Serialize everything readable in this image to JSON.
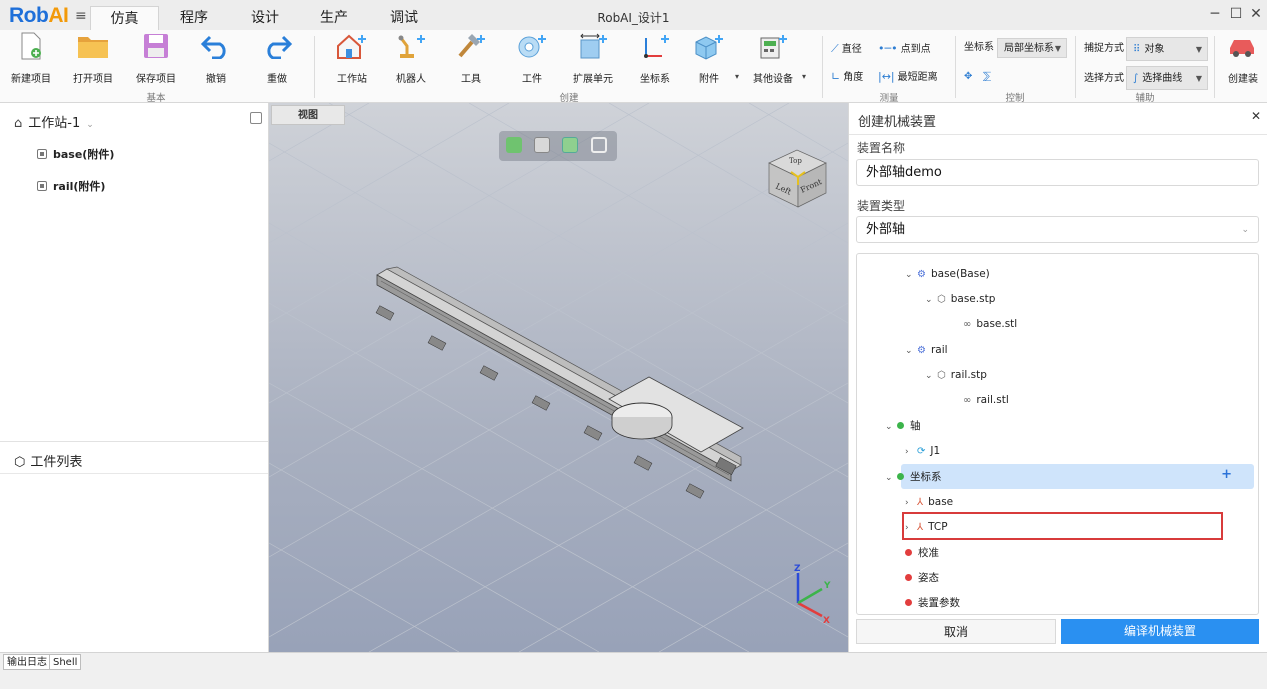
{
  "app": {
    "logo_main": "Rob",
    "logo_accent": "AI",
    "window_title": "RobAI_设计1"
  },
  "tabs": [
    {
      "label": "仿真"
    },
    {
      "label": "程序"
    },
    {
      "label": "设计"
    },
    {
      "label": "生产"
    },
    {
      "label": "调试"
    }
  ],
  "ribbon": {
    "buttons": [
      {
        "label": "新建项目",
        "icon": "new-file-icon"
      },
      {
        "label": "打开项目",
        "icon": "folder-icon"
      },
      {
        "label": "保存项目",
        "icon": "save-icon"
      },
      {
        "label": "撤销",
        "icon": "undo-icon"
      },
      {
        "label": "重做",
        "icon": "redo-icon"
      },
      {
        "label": "工作站",
        "icon": "workstation-icon"
      },
      {
        "label": "机器人",
        "icon": "robot-icon"
      },
      {
        "label": "工具",
        "icon": "tool-icon"
      },
      {
        "label": "工件",
        "icon": "workpiece-icon"
      },
      {
        "label": "扩展单元",
        "icon": "extension-unit-icon"
      },
      {
        "label": "坐标系",
        "icon": "coordinate-icon"
      },
      {
        "label": "附件",
        "icon": "attachment-icon"
      },
      {
        "label": "其他设备",
        "icon": "other-device-icon"
      },
      {
        "label": "创建装",
        "icon": "create-device-icon"
      }
    ],
    "groups": {
      "basic": "基本",
      "create": "创建",
      "measure": "测量",
      "control": "控制",
      "assist": "辅助"
    },
    "measure": {
      "diameter": "直径",
      "point_to_point": "点到点",
      "angle": "角度",
      "min_distance": "最短距离"
    },
    "control": {
      "coord_label": "坐标系",
      "coord_value": "局部坐标系"
    },
    "assist": {
      "capture_label": "捕捉方式",
      "capture_value": "对象",
      "select_label": "选择方式",
      "select_value": "选择曲线"
    }
  },
  "left": {
    "workstation_title": "工作站-1",
    "items": [
      {
        "label": "base(附件)"
      },
      {
        "label": "rail(附件)"
      }
    ],
    "parts_title": "工件列表"
  },
  "viewport": {
    "tab_label": "视图",
    "cube_top": "Top",
    "cube_left": "Left",
    "cube_front": "Front",
    "axis_x": "X",
    "axis_y": "Y",
    "axis_z": "Z"
  },
  "panel": {
    "title": "创建机械装置",
    "name_label": "装置名称",
    "name_value": "外部轴demo",
    "type_label": "装置类型",
    "type_value": "外部轴",
    "tree": [
      {
        "label": "base(Base)"
      },
      {
        "label": "base.stp"
      },
      {
        "label": "base.stl"
      },
      {
        "label": "rail"
      },
      {
        "label": "rail.stp"
      },
      {
        "label": "rail.stl"
      },
      {
        "label": "轴"
      },
      {
        "label": "J1"
      },
      {
        "label": "坐标系"
      },
      {
        "label": "base"
      },
      {
        "label": "TCP"
      },
      {
        "label": "校准"
      },
      {
        "label": "姿态"
      },
      {
        "label": "装置参数"
      }
    ],
    "status_colors": {
      "ok": "#3cb44b",
      "error": "#e23d3d"
    },
    "cancel_label": "取消",
    "compile_label": "编译机械装置"
  },
  "statusbar": {
    "tabs": [
      {
        "label": "输出日志"
      },
      {
        "label": "Shell"
      }
    ]
  }
}
